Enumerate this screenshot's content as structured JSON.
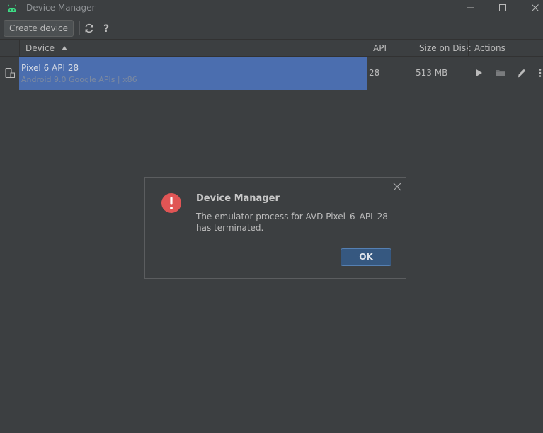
{
  "window": {
    "title": "Device Manager",
    "app_icon": "android-icon",
    "controls": [
      "minimize-icon",
      "maximize-icon",
      "close-icon"
    ]
  },
  "toolbar": {
    "create_label": "Create device",
    "refresh_icon": "refresh-icon",
    "help_label": "?"
  },
  "table": {
    "columns": {
      "device": "Device",
      "api": "API",
      "size": "Size on Disk",
      "actions": "Actions"
    },
    "sort": {
      "column": "device",
      "direction": "ascending"
    },
    "rows": [
      {
        "name": "Pixel 6 API 28",
        "details": "Android 9.0 Google APIs | x86",
        "api": "28",
        "size": "513 MB",
        "selected": true,
        "actions": [
          "play-icon",
          "folder-icon",
          "edit-icon",
          "more-icon"
        ]
      }
    ]
  },
  "dialog": {
    "title": "Device Manager",
    "message": "The emulator process for AVD Pixel_6_API_28 has terminated.",
    "ok_label": "OK",
    "icon": "error-icon"
  },
  "colors": {
    "background": "#3c3f41",
    "selection": "#4b6eaf",
    "ok_button": "#365880",
    "error": "#e05555",
    "android_green": "#3ddc84"
  }
}
